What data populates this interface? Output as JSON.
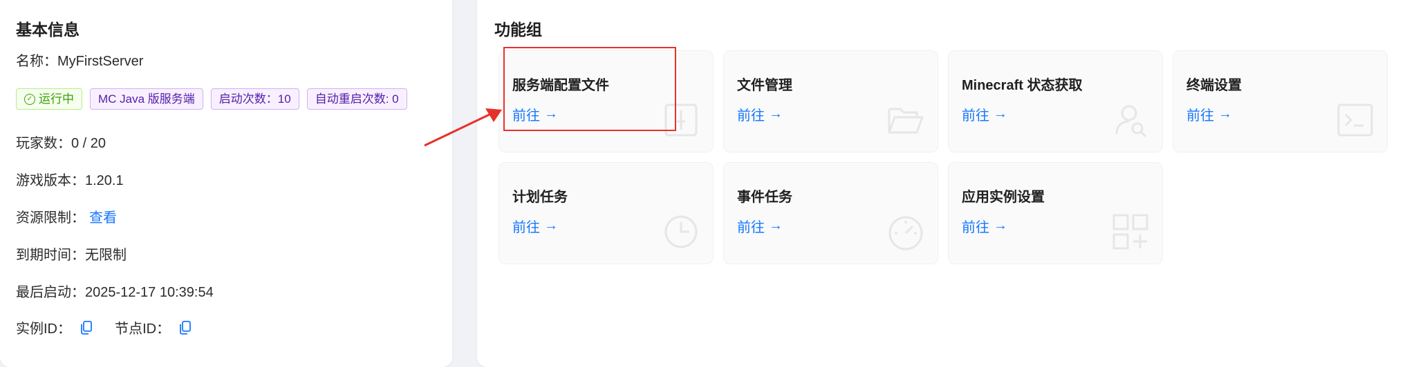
{
  "basic_info": {
    "title": "基本信息",
    "name_label": "名称：",
    "name_value": "MyFirstServer",
    "tags": [
      {
        "label": "运行中",
        "color": "#389e0d",
        "icon": "check-circle-icon"
      },
      {
        "label": "MC Java 版服务端",
        "color": "#531dab"
      },
      {
        "label": "启动次数：10",
        "color": "#531dab"
      },
      {
        "label": "自动重启次数: 0",
        "color": "#531dab"
      }
    ],
    "players_label": "玩家数：",
    "players_value": "0 / 20",
    "version_label": "游戏版本：",
    "version_value": "1.20.1",
    "resource_label": "资源限制：",
    "resource_link": "查看",
    "expire_label": "到期时间：",
    "expire_value": "无限制",
    "last_start_label": "最后启动：",
    "last_start_value": "2025-12-17 10:39:54",
    "instance_id_label": "实例ID：",
    "node_id_label": "节点ID："
  },
  "function_group": {
    "title": "功能组",
    "go_label": "前往",
    "tiles": [
      {
        "title": "服务端配置文件",
        "icon": "file-settings-icon"
      },
      {
        "title": "文件管理",
        "icon": "folder-open-icon"
      },
      {
        "title": "Minecraft 状态获取",
        "icon": "user-search-icon"
      },
      {
        "title": "终端设置",
        "icon": "terminal-icon"
      },
      {
        "title": "计划任务",
        "icon": "clock-icon"
      },
      {
        "title": "事件任务",
        "icon": "dashboard-icon"
      },
      {
        "title": "应用实例设置",
        "icon": "appstore-add-icon"
      }
    ]
  },
  "colors": {
    "link": "#1677ff",
    "highlight": "#e8302a"
  }
}
